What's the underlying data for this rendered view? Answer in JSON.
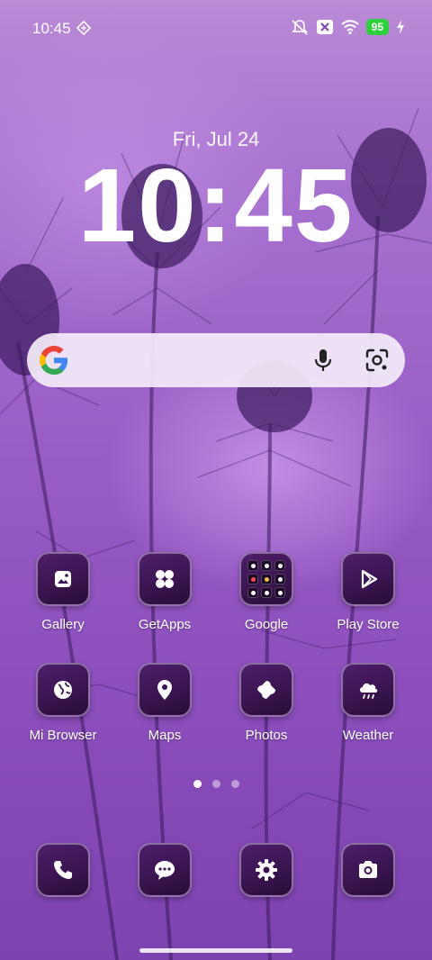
{
  "status_bar": {
    "time": "10:45",
    "battery": "95",
    "icons": [
      "notifications-muted-icon",
      "x-app-icon",
      "wifi-icon",
      "battery-icon",
      "charging-icon"
    ]
  },
  "lockscreen_widget": {
    "date": "Fri, Jul 24",
    "clock": "10:45"
  },
  "search_bar": {
    "icons": [
      "google-logo",
      "mic-icon",
      "google-lens-icon"
    ]
  },
  "apps": [
    {
      "label": "Gallery",
      "icon": "gallery-icon"
    },
    {
      "label": "GetApps",
      "icon": "getapps-icon"
    },
    {
      "label": "Google",
      "icon": "google-folder-icon"
    },
    {
      "label": "Play Store",
      "icon": "play-store-icon"
    },
    {
      "label": "Mi Browser",
      "icon": "browser-globe-icon"
    },
    {
      "label": "Maps",
      "icon": "maps-pin-icon"
    },
    {
      "label": "Photos",
      "icon": "photos-pinwheel-icon"
    },
    {
      "label": "Weather",
      "icon": "weather-cloud-icon"
    }
  ],
  "page_indicator": {
    "pages": 3,
    "active": 1
  },
  "dock": [
    {
      "icon": "phone-icon"
    },
    {
      "icon": "messages-icon"
    },
    {
      "icon": "settings-gear-icon"
    },
    {
      "icon": "camera-icon"
    }
  ],
  "colors": {
    "wallpaper_top": "#b98ad6",
    "wallpaper_bottom": "#7d43b0",
    "icon_background": "#3a1352",
    "battery_green": "#2fd03d"
  }
}
